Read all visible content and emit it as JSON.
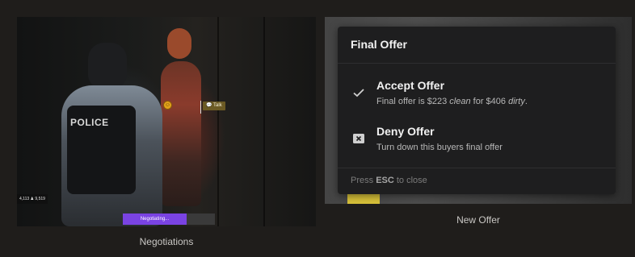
{
  "colors": {
    "page_background": "#1f1d1b",
    "progress_accent": "#7a43e3",
    "menu_background": "#1e1e1f",
    "talk_tag": "#6b5a24"
  },
  "left_card": {
    "caption": "Negotiations",
    "scene": {
      "police_text": "POLICE",
      "talk_label": "Talk",
      "talk_icon": "chat-bubbles-icon",
      "npc_marker_icon": "smile-marker-icon",
      "hud_stats": "4,113 ♟ 9,519"
    },
    "progress": {
      "label": "Negotiating...",
      "fill_fraction": 0.69
    }
  },
  "right_card": {
    "caption": "New Offer",
    "menu": {
      "title": "Final Offer",
      "options": [
        {
          "icon": "checkmark-icon",
          "title": "Accept Offer",
          "desc_prefix": "Final offer is $223 ",
          "desc_em1": "clean",
          "desc_mid": " for $406 ",
          "desc_em2": "dirty",
          "desc_suffix": "."
        },
        {
          "icon": "close-box-icon",
          "title": "Deny Offer",
          "description": "Turn down this buyers final offer"
        }
      ],
      "footer": {
        "prefix": "Press ",
        "key": "ESC",
        "suffix": " to close"
      }
    }
  }
}
